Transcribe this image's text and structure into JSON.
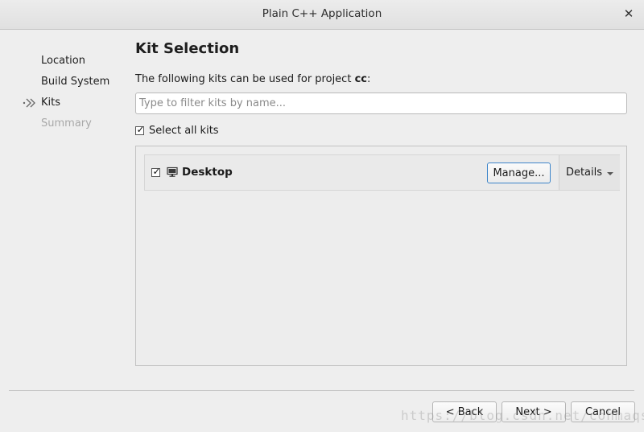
{
  "window": {
    "title": "Plain C++ Application"
  },
  "steps": [
    {
      "label": "Location"
    },
    {
      "label": "Build System"
    },
    {
      "label": "Kits"
    },
    {
      "label": "Summary"
    }
  ],
  "page": {
    "title": "Kit Selection",
    "description_prefix": "The following kits can be used for project ",
    "project_name": "cc",
    "description_suffix": ":"
  },
  "filter": {
    "placeholder": "Type to filter kits by name...",
    "value": ""
  },
  "select_all": {
    "label": "Select all kits",
    "checked": true
  },
  "kits": [
    {
      "name": "Desktop",
      "checked": true,
      "icon": "monitor-icon",
      "manage_label": "Manage...",
      "details_label": "Details"
    }
  ],
  "footer": {
    "back_label": "< Back",
    "next_label": "Next >",
    "cancel_label": "Cancel"
  },
  "watermark": "https://blog.csdn.net/cohmaqs"
}
